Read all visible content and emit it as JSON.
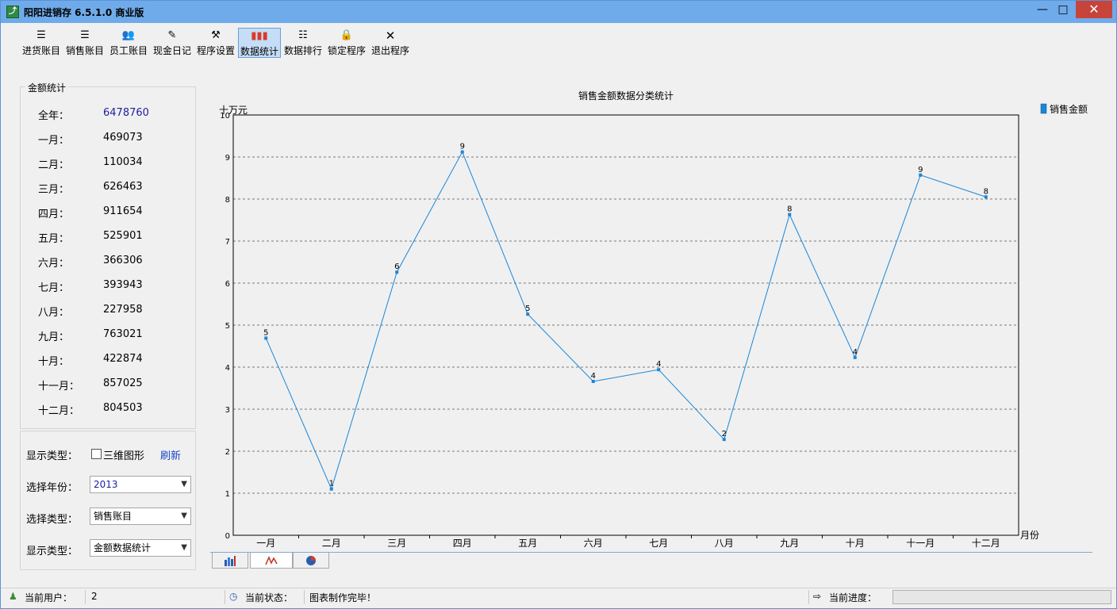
{
  "window": {
    "title": "阳阳进销存 6.5.1.0 商业版",
    "min": "—",
    "max": "□",
    "close": "✕"
  },
  "toolbar": [
    {
      "label": "进货账目",
      "icon": "list-lines-icon"
    },
    {
      "label": "销售账目",
      "icon": "list-lines-icon"
    },
    {
      "label": "员工账目",
      "icon": "people-icon"
    },
    {
      "label": "现金日记",
      "icon": "notepad-pen-icon"
    },
    {
      "label": "程序设置",
      "icon": "tools-icon"
    },
    {
      "label": "数据统计",
      "icon": "bar-chart-icon"
    },
    {
      "label": "数据排行",
      "icon": "ranking-list-icon"
    },
    {
      "label": "锁定程序",
      "icon": "lock-icon"
    },
    {
      "label": "退出程序",
      "icon": "close-x-icon"
    }
  ],
  "stats": {
    "title": "金额统计",
    "rows": [
      {
        "label": "全年：",
        "value": "6478760"
      },
      {
        "label": "一月：",
        "value": "469073"
      },
      {
        "label": "二月：",
        "value": "110034"
      },
      {
        "label": "三月：",
        "value": "626463"
      },
      {
        "label": "四月：",
        "value": "911654"
      },
      {
        "label": "五月：",
        "value": "525901"
      },
      {
        "label": "六月：",
        "value": "366306"
      },
      {
        "label": "七月：",
        "value": "393943"
      },
      {
        "label": "八月：",
        "value": "227958"
      },
      {
        "label": "九月：",
        "value": "763021"
      },
      {
        "label": "十月：",
        "value": "422874"
      },
      {
        "label": "十一月：",
        "value": "857025"
      },
      {
        "label": "十二月：",
        "value": "804503"
      }
    ]
  },
  "controls": {
    "display_type_label": "显示类型：",
    "three_d_label": "三维图形",
    "refresh_label": "刷新",
    "year_label": "选择年份：",
    "year_value": "2013",
    "type_label": "选择类型：",
    "type_value": "销售账目",
    "display_type2_label": "显示类型：",
    "display_value": "金额数据统计"
  },
  "chart_data": {
    "type": "line",
    "title": "销售金额数据分类统计",
    "ylabel": "十万元",
    "xlabel": "月份",
    "ylim": [
      0,
      10
    ],
    "yticks": [
      "0",
      "1",
      "2",
      "3",
      "4",
      "5",
      "6",
      "7",
      "8",
      "9",
      "10"
    ],
    "grid": true,
    "legend_position": "top-right",
    "categories": [
      "一月",
      "二月",
      "三月",
      "四月",
      "五月",
      "六月",
      "七月",
      "八月",
      "九月",
      "十月",
      "十一月",
      "十二月"
    ],
    "series": [
      {
        "name": "销售金额",
        "color": "#1a86d8",
        "values": [
          4.69,
          1.1,
          6.26,
          9.12,
          5.26,
          3.66,
          3.94,
          2.28,
          7.63,
          4.23,
          8.57,
          8.05
        ],
        "labels": [
          "5",
          "1",
          "6",
          "9",
          "5",
          "4",
          "4",
          "2",
          "8",
          "4",
          "9",
          "8"
        ]
      }
    ]
  },
  "chart_tabs": [
    {
      "icon": "bar-chart-icon",
      "active": false
    },
    {
      "icon": "line-chart-icon",
      "active": true
    },
    {
      "icon": "pie-chart-icon",
      "active": false
    }
  ],
  "status": {
    "user_label": "当前用户：",
    "user_value": "2",
    "state_label": "当前状态：",
    "state_value": "图表制作完毕！",
    "progress_label": "当前进度："
  }
}
